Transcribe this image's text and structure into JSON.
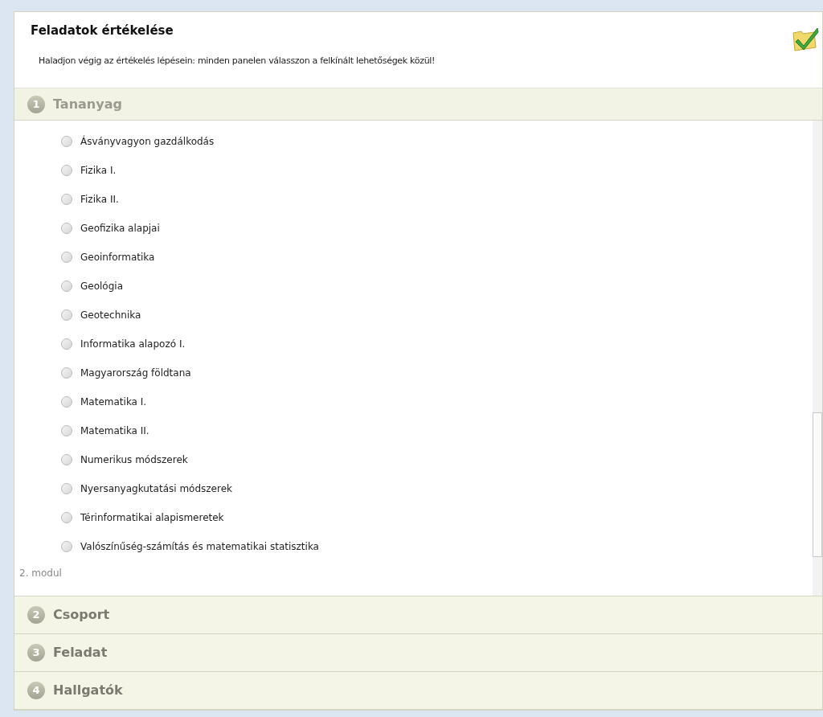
{
  "header": {
    "title": "Feladatok értékelése",
    "instruction": "Haladjon végig az értékelés lépésein: minden panelen válasszon a felkínált lehetőségek közül!"
  },
  "steps": [
    {
      "number": "1",
      "label": "Tananyag",
      "expanded": true,
      "options": [
        {
          "label": "Ásványvagyon gazdálkodás",
          "selected": false
        },
        {
          "label": "Fizika I.",
          "selected": false
        },
        {
          "label": "Fizika II.",
          "selected": false
        },
        {
          "label": "Geofizika alapjai",
          "selected": false
        },
        {
          "label": "Geoinformatika",
          "selected": false
        },
        {
          "label": "Geológia",
          "selected": false
        },
        {
          "label": "Geotechnika",
          "selected": false
        },
        {
          "label": "Informatika alapozó I.",
          "selected": false
        },
        {
          "label": "Magyarország földtana",
          "selected": false
        },
        {
          "label": "Matematika I.",
          "selected": false
        },
        {
          "label": "Matematika II.",
          "selected": false
        },
        {
          "label": "Numerikus módszerek",
          "selected": false
        },
        {
          "label": "Nyersanyagkutatási módszerek",
          "selected": false
        },
        {
          "label": "Térinformatikai alapismeretek",
          "selected": false
        },
        {
          "label": "Valószínűség-számítás és matematikai statisztika",
          "selected": false
        }
      ],
      "group_label": "2. modul"
    },
    {
      "number": "2",
      "label": "Csoport",
      "expanded": false
    },
    {
      "number": "3",
      "label": "Feladat",
      "expanded": false
    },
    {
      "number": "4",
      "label": "Hallgatók",
      "expanded": false
    }
  ]
}
